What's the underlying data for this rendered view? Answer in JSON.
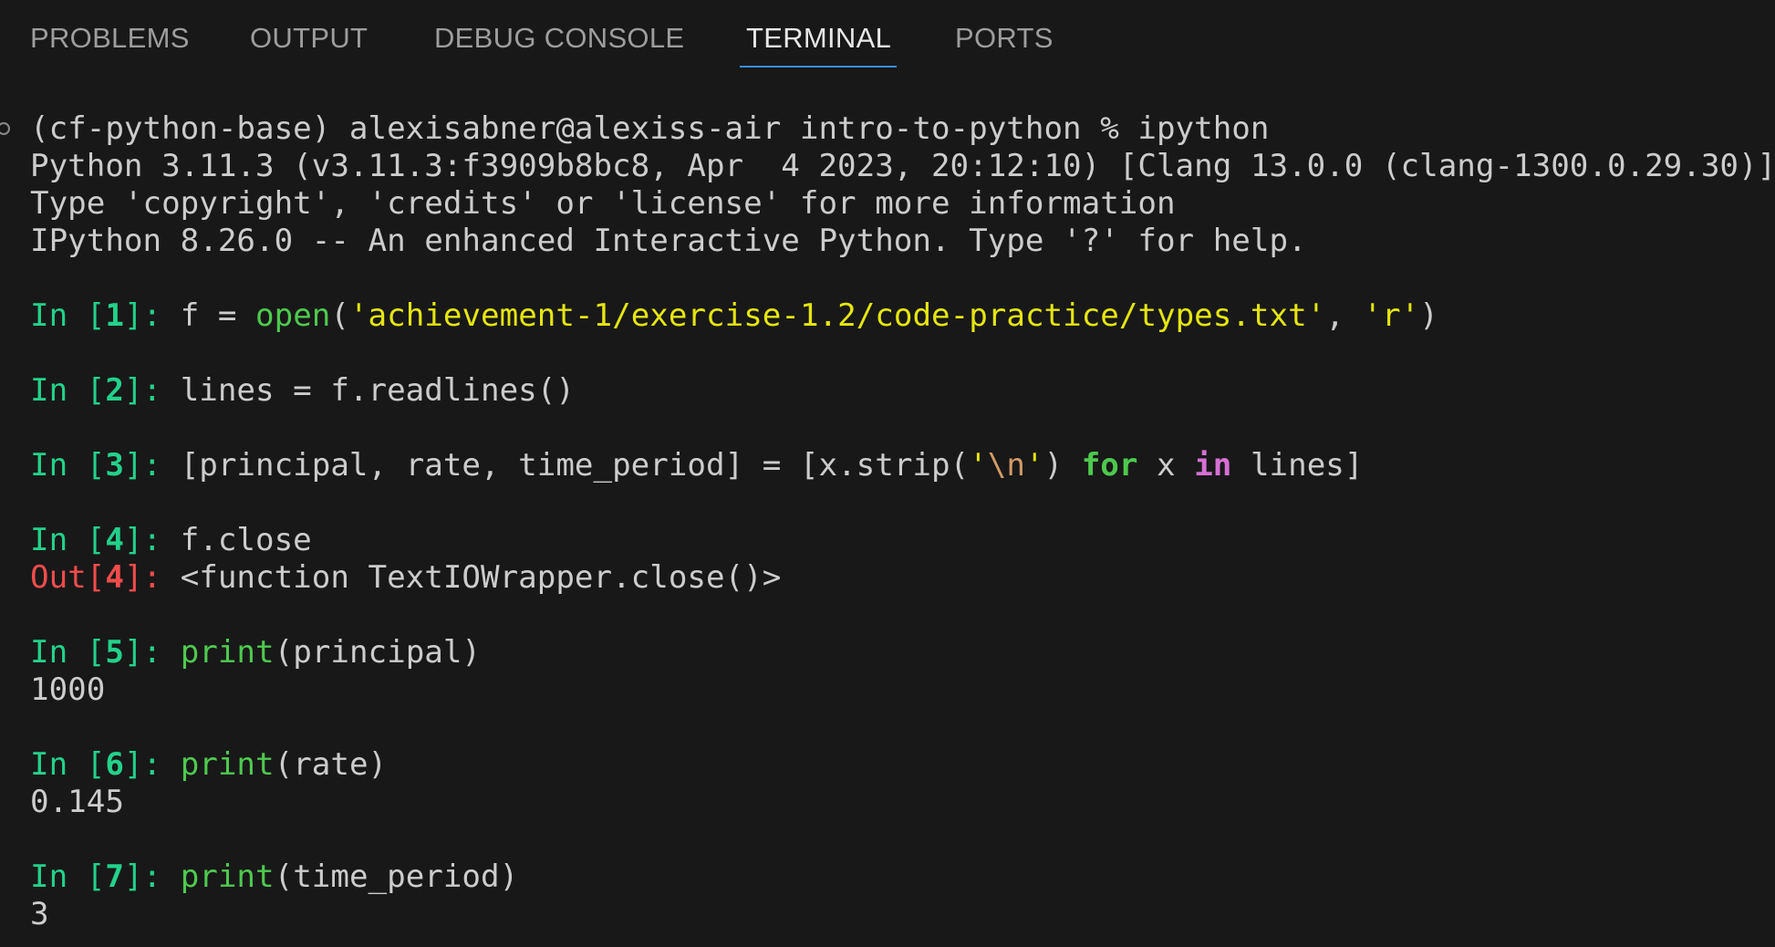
{
  "panel": {
    "tabs": [
      {
        "label": "PROBLEMS"
      },
      {
        "label": "OUTPUT"
      },
      {
        "label": "DEBUG CONSOLE"
      },
      {
        "label": "TERMINAL",
        "active": true
      },
      {
        "label": "PORTS"
      }
    ]
  },
  "terminal": {
    "shell_prompt": "(cf-python-base) alexisabner@alexiss-air intro-to-python % ipython",
    "banner": [
      "Python 3.11.3 (v3.11.3:f3909b8bc8, Apr  4 2023, 20:12:10) [Clang 13.0.0 (clang-1300.0.29.30)]",
      "Type 'copyright', 'credits' or 'license' for more information",
      "IPython 8.26.0 -- An enhanced Interactive Python. Type '?' for help."
    ],
    "cells": [
      {
        "in_prefix": "In [",
        "number": "1",
        "suffix": "]: ",
        "code": {
          "pre": "f = ",
          "fn": "open",
          "open_paren": "(",
          "path": "'achievement-1/exercise-1.2/code-practice/types.txt'",
          "comma": ", ",
          "mode": "'r'",
          "close_paren": ")"
        }
      },
      {
        "in_prefix": "In [",
        "number": "2",
        "suffix": "]: ",
        "code": {
          "text": "lines = f.readlines()"
        }
      },
      {
        "in_prefix": "In [",
        "number": "3",
        "suffix": "]: ",
        "code": {
          "pre": "[principal, rate, time_period] = [x.strip(",
          "quote_open": "'",
          "escape": "\\n",
          "quote_close": "'",
          "mid": ") ",
          "kw_for": "for",
          "mid2": " x ",
          "kw_in": "in",
          "post": " lines]"
        }
      },
      {
        "in_prefix": "In [",
        "number": "4",
        "suffix": "]: ",
        "code": {
          "text": "f.close"
        },
        "out_prefix": "Out[",
        "out_number": "4",
        "out_suffix": "]: ",
        "out_text": "<function TextIOWrapper.close()>"
      },
      {
        "in_prefix": "In [",
        "number": "5",
        "suffix": "]: ",
        "code": {
          "fn": "print",
          "args": "(principal)"
        },
        "output": "1000"
      },
      {
        "in_prefix": "In [",
        "number": "6",
        "suffix": "]: ",
        "code": {
          "fn": "print",
          "args": "(rate)"
        },
        "output": "0.145"
      },
      {
        "in_prefix": "In [",
        "number": "7",
        "suffix": "]: ",
        "code": {
          "fn": "print",
          "args": "(time_period)"
        },
        "output": "3"
      }
    ]
  }
}
